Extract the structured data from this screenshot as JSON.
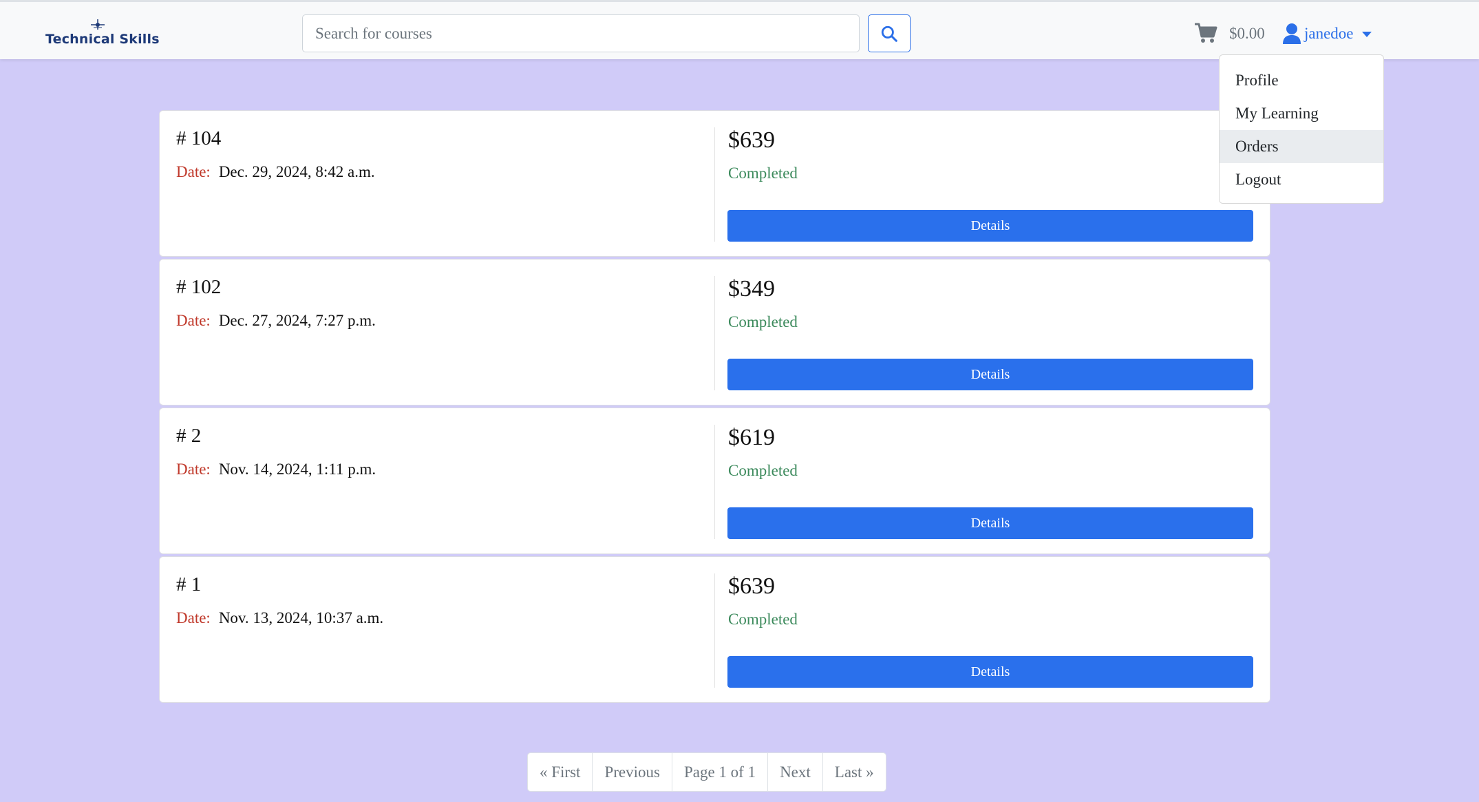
{
  "brand": {
    "name": "Technical Skills"
  },
  "search": {
    "placeholder": "Search for courses"
  },
  "cart": {
    "total": "$0.00"
  },
  "user": {
    "name": "janedoe"
  },
  "user_menu": {
    "items": [
      {
        "label": "Profile"
      },
      {
        "label": "My Learning"
      },
      {
        "label": "Orders"
      },
      {
        "label": "Logout"
      }
    ],
    "active_item": "Orders"
  },
  "orders": [
    {
      "id": "# 104",
      "date_label": "Date:",
      "date": "Dec. 29, 2024, 8:42 a.m.",
      "price": "$639",
      "status": "Completed",
      "button": "Details"
    },
    {
      "id": "# 102",
      "date_label": "Date:",
      "date": "Dec. 27, 2024, 7:27 p.m.",
      "price": "$349",
      "status": "Completed",
      "button": "Details"
    },
    {
      "id": "# 2",
      "date_label": "Date:",
      "date": "Nov. 14, 2024, 1:11 p.m.",
      "price": "$619",
      "status": "Completed",
      "button": "Details"
    },
    {
      "id": "# 1",
      "date_label": "Date:",
      "date": "Nov. 13, 2024, 10:37 a.m.",
      "price": "$639",
      "status": "Completed",
      "button": "Details"
    }
  ],
  "pagination": {
    "first": "« First",
    "previous": "Previous",
    "current": "Page 1 of 1",
    "next": "Next",
    "last": "Last »"
  },
  "colors": {
    "page_background": "#d0cbf8",
    "primary": "#2a70ec",
    "status_completed": "#3c8a5c",
    "date_label": "#c0392b",
    "brand": "#1e3a78"
  },
  "icons": {
    "brand": "drone-logo-icon",
    "search": "search-icon",
    "cart": "cart-icon",
    "user": "user-icon",
    "caret": "caret-down-icon"
  }
}
